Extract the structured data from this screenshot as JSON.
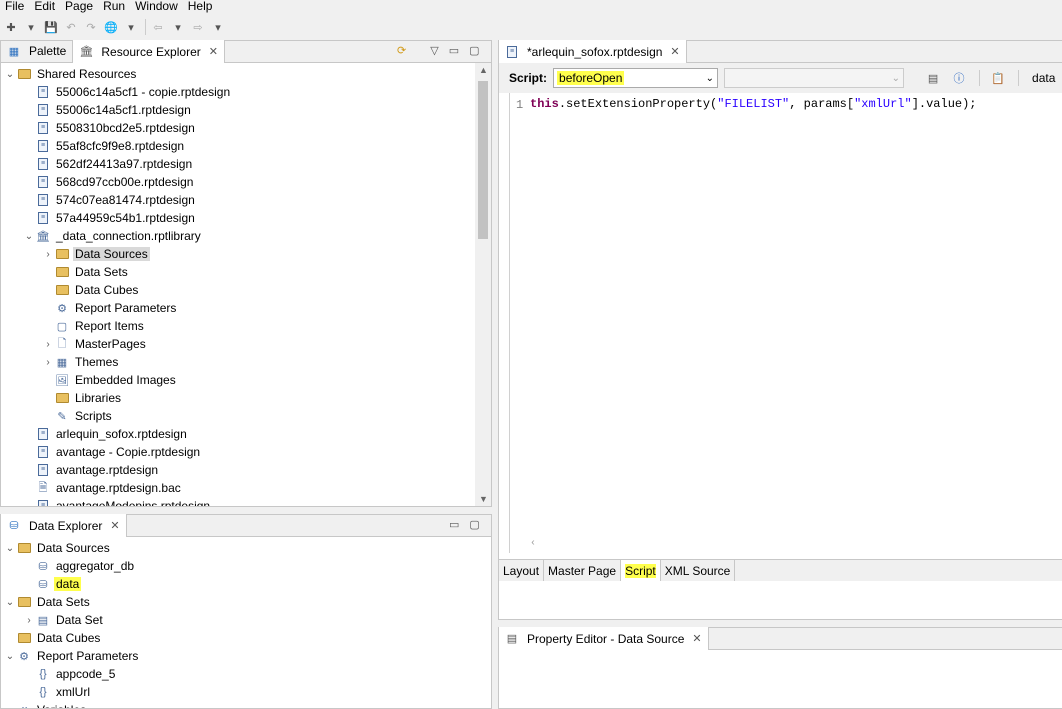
{
  "menu": [
    "File",
    "Edit",
    "Page",
    "Run",
    "Window",
    "Help"
  ],
  "resource_panel": {
    "tabs": [
      "Palette",
      "Resource Explorer"
    ],
    "items": [
      {
        "label": "Shared Resources",
        "depth": 0,
        "tw": "expanded",
        "icon": "folder-open-icon"
      },
      {
        "label": "55006c14a5cf1 - copie.rptdesign",
        "depth": 1,
        "icon": "report-design-icon"
      },
      {
        "label": "55006c14a5cf1.rptdesign",
        "depth": 1,
        "icon": "report-design-icon"
      },
      {
        "label": "5508310bcd2e5.rptdesign",
        "depth": 1,
        "icon": "report-design-icon"
      },
      {
        "label": "55af8cfc9f9e8.rptdesign",
        "depth": 1,
        "icon": "report-design-icon"
      },
      {
        "label": "562df24413a97.rptdesign",
        "depth": 1,
        "icon": "report-design-icon"
      },
      {
        "label": "568cd97ccb00e.rptdesign",
        "depth": 1,
        "icon": "report-design-icon"
      },
      {
        "label": "574c07ea81474.rptdesign",
        "depth": 1,
        "icon": "report-design-icon"
      },
      {
        "label": "57a44959c54b1.rptdesign",
        "depth": 1,
        "icon": "report-design-icon"
      },
      {
        "label": "_data_connection.rptlibrary",
        "depth": 1,
        "tw": "expanded",
        "icon": "library-icon"
      },
      {
        "label": "Data Sources",
        "depth": 2,
        "tw": "collapsed",
        "icon": "data-sources-folder-icon",
        "selected": true
      },
      {
        "label": "Data Sets",
        "depth": 2,
        "icon": "data-sets-folder-icon"
      },
      {
        "label": "Data Cubes",
        "depth": 2,
        "icon": "data-cubes-folder-icon"
      },
      {
        "label": "Report Parameters",
        "depth": 2,
        "icon": "report-parameters-icon"
      },
      {
        "label": "Report Items",
        "depth": 2,
        "icon": "report-items-icon"
      },
      {
        "label": "MasterPages",
        "depth": 2,
        "tw": "collapsed",
        "icon": "master-pages-icon"
      },
      {
        "label": "Themes",
        "depth": 2,
        "tw": "collapsed",
        "icon": "themes-icon"
      },
      {
        "label": "Embedded Images",
        "depth": 2,
        "icon": "embedded-images-icon"
      },
      {
        "label": "Libraries",
        "depth": 2,
        "icon": "libraries-folder-icon"
      },
      {
        "label": "Scripts",
        "depth": 2,
        "icon": "scripts-icon"
      },
      {
        "label": "arlequin_sofox.rptdesign",
        "depth": 1,
        "icon": "report-design-icon"
      },
      {
        "label": "avantage - Copie.rptdesign",
        "depth": 1,
        "icon": "report-design-icon"
      },
      {
        "label": "avantage.rptdesign",
        "depth": 1,
        "icon": "report-design-icon"
      },
      {
        "label": "avantage.rptdesign.bac",
        "depth": 1,
        "icon": "file-icon"
      },
      {
        "label": "avantageModepins.rptdesign",
        "depth": 1,
        "icon": "report-design-icon"
      }
    ]
  },
  "data_panel": {
    "tab": "Data Explorer",
    "items": [
      {
        "label": "Data Sources",
        "depth": 0,
        "tw": "expanded",
        "icon": "data-sources-folder-icon"
      },
      {
        "label": "aggregator_db",
        "depth": 1,
        "icon": "datasource-icon"
      },
      {
        "label": "data",
        "depth": 1,
        "icon": "datasource-icon",
        "highlight": true
      },
      {
        "label": "Data Sets",
        "depth": 0,
        "tw": "expanded",
        "icon": "data-sets-folder-icon"
      },
      {
        "label": "Data Set",
        "depth": 1,
        "tw": "collapsed",
        "icon": "dataset-icon"
      },
      {
        "label": "Data Cubes",
        "depth": 0,
        "icon": "data-cubes-folder-icon"
      },
      {
        "label": "Report Parameters",
        "depth": 0,
        "tw": "expanded",
        "icon": "report-parameters-icon"
      },
      {
        "label": "appcode_5",
        "depth": 1,
        "icon": "parameter-icon"
      },
      {
        "label": "xmlUrl",
        "depth": 1,
        "icon": "parameter-icon"
      },
      {
        "label": "Variables",
        "depth": 0,
        "tw": "collapsed",
        "icon": "variables-icon"
      }
    ]
  },
  "editor": {
    "tab": "*arlequin_sofox.rptdesign",
    "script_label": "Script:",
    "script_value": "beforeOpen",
    "data_label": "data",
    "line_number": "1",
    "code": {
      "kw": "this",
      "p1": ".setExtensionProperty(",
      "s1": "\"FILELIST\"",
      "p2": ", params[",
      "s2": "\"xmlUrl\"",
      "p3": "].value);"
    },
    "bottom_tabs": [
      "Layout",
      "Master Page",
      "Script",
      "XML Source"
    ],
    "active_bottom_tab": "Script"
  },
  "property_editor": {
    "tab": "Property Editor - Data Source"
  },
  "colors": {
    "highlight": "#ffff4d",
    "selection": "#d9d9d9",
    "keyword": "#7f0055",
    "string": "#2a00ff"
  }
}
